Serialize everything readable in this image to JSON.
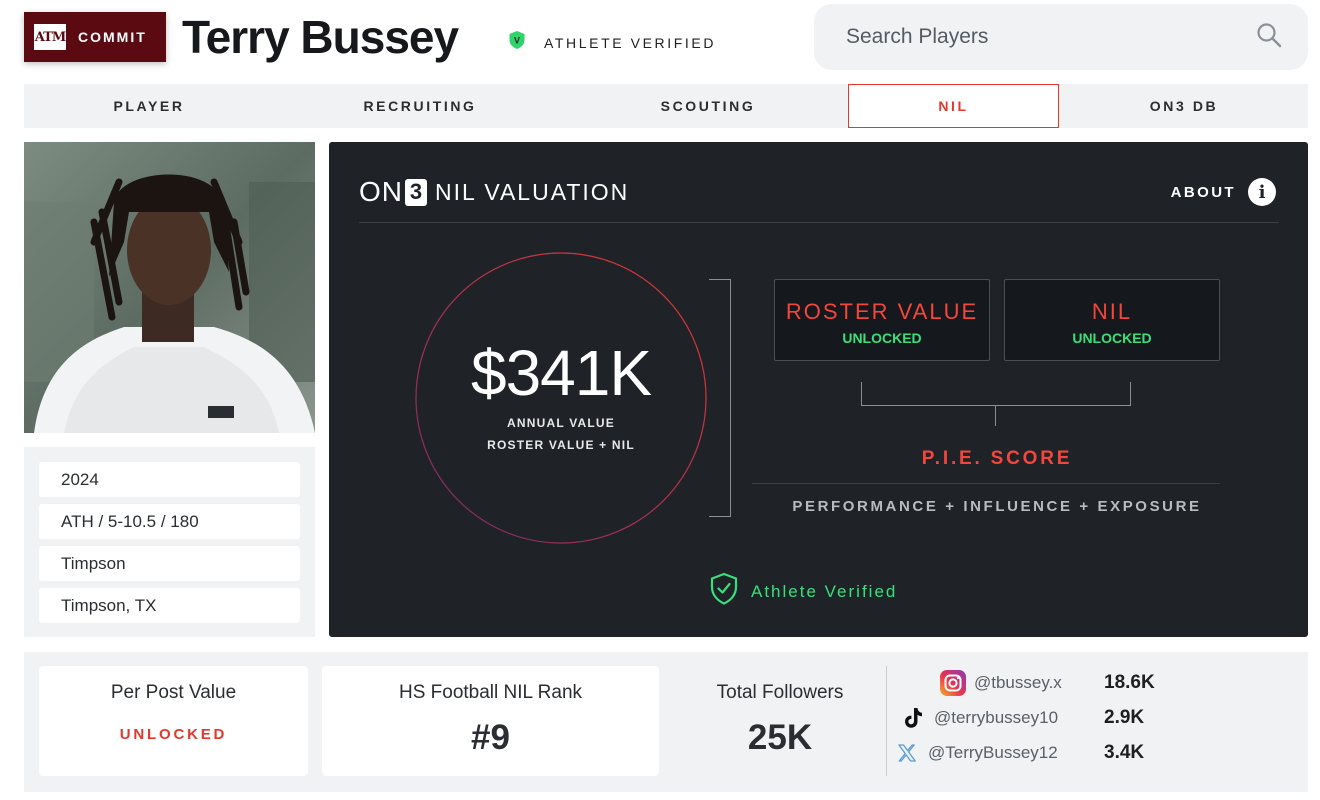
{
  "header": {
    "commit_label": "COMMIT",
    "school_logo_text": "ATM",
    "player_name": "Terry Bussey",
    "verified_label": "ATHLETE VERIFIED"
  },
  "search": {
    "placeholder": "Search Players"
  },
  "nav": {
    "tabs": [
      {
        "label": "PLAYER"
      },
      {
        "label": "RECRUITING"
      },
      {
        "label": "SCOUTING"
      },
      {
        "label": "NIL"
      },
      {
        "label": "ON3 DB"
      }
    ],
    "active_tab": "NIL"
  },
  "player_info": {
    "class_year": "2024",
    "position_size": "ATH / 5-10.5 / 180",
    "high_school": "Timpson",
    "hometown": "Timpson, TX"
  },
  "nil_panel": {
    "logo_on": "ON",
    "logo_three": "3",
    "title": "NIL VALUATION",
    "about_label": "ABOUT",
    "valuation": "$341K",
    "valuation_sub1": "ANNUAL VALUE",
    "valuation_sub2": "ROSTER VALUE + NIL",
    "roster_value": {
      "title": "ROSTER VALUE",
      "status": "UNLOCKED"
    },
    "nil": {
      "title": "NIL",
      "status": "UNLOCKED"
    },
    "pie_score_label": "P.I.E. SCORE",
    "pie_formula": "PERFORMANCE + INFLUENCE + EXPOSURE",
    "athlete_verified": "Athlete Verified"
  },
  "stats": {
    "per_post": {
      "label": "Per Post Value",
      "value": "UNLOCKED"
    },
    "nil_rank": {
      "label": "HS Football NIL Rank",
      "value": "#9"
    },
    "total_followers": {
      "label": "Total Followers",
      "value": "25K"
    },
    "socials": [
      {
        "platform": "instagram",
        "icon": "instagram-icon",
        "handle": "@tbussey.x",
        "count": "18.6K"
      },
      {
        "platform": "tiktok",
        "icon": "tiktok-icon",
        "handle": "@terrybussey10",
        "count": "2.9K"
      },
      {
        "platform": "x",
        "icon": "x-icon",
        "handle": "@TerryBussey12",
        "count": "3.4K"
      }
    ]
  },
  "colors": {
    "maroon": "#5c0a11",
    "accent_red": "#e5372c",
    "verified_green": "#39e07a",
    "panel_dark": "#1f2328"
  }
}
